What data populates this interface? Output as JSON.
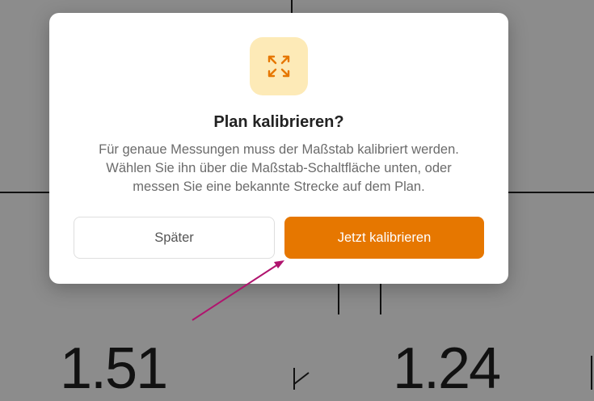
{
  "background": {
    "measurements": [
      "1.51",
      "1.24"
    ]
  },
  "dialog": {
    "icon": "expand-arrows-icon",
    "title": "Plan kalibrieren?",
    "description_lines": [
      "Für genaue Messungen muss der Maßstab kalibriert werden.",
      "Wählen Sie ihn über die Maßstab-Schaltfläche unten, oder",
      "messen Sie eine bekannte Strecke auf dem Plan."
    ],
    "later_label": "Später",
    "calibrate_label": "Jetzt kalibrieren"
  },
  "colors": {
    "accent": "#e67700",
    "icon_bg": "#fdeab7",
    "annotation_arrow": "#b0146e"
  }
}
